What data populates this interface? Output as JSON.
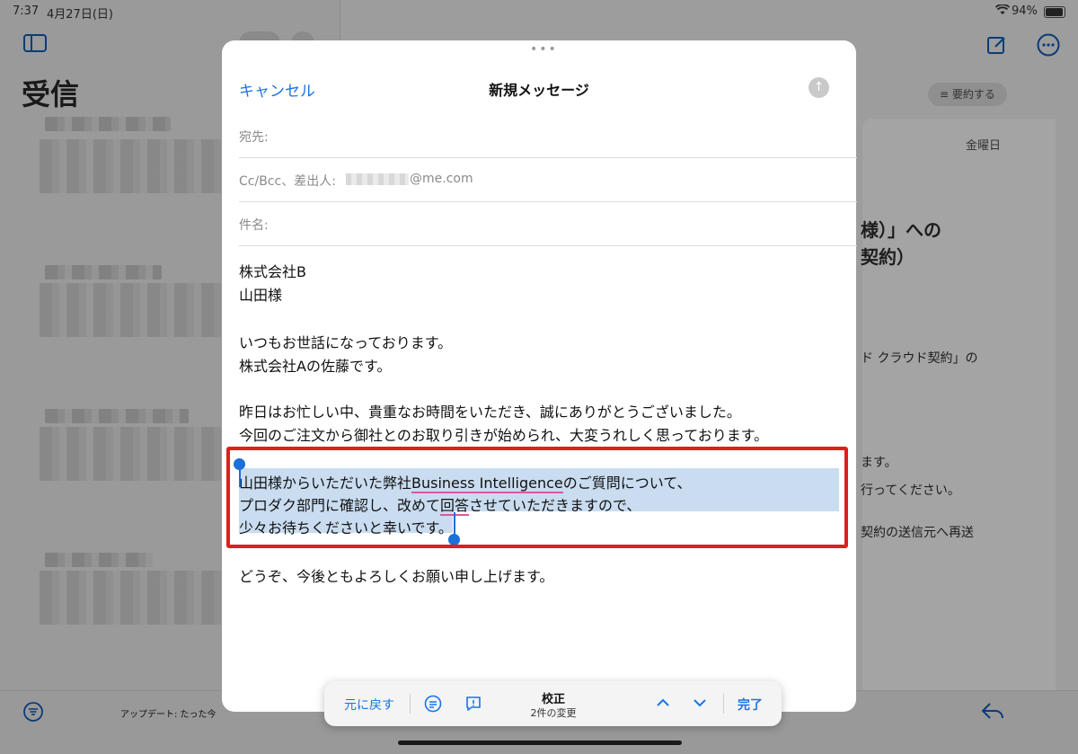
{
  "status_bar": {
    "time": "7:37",
    "date": "4月27日(日)",
    "battery": "94%"
  },
  "mailbox": {
    "title": "受信",
    "update_status": "アップデート: たった今",
    "summarize_label": "要約する",
    "detail_day": "金曜日"
  },
  "background_text": {
    "heading_line1": "様）」への",
    "heading_line2": "契約）",
    "line1": "ド クラウド契約」の",
    "line2": "ます。",
    "line3": "行ってください。",
    "line4": "契約の送信元へ再送"
  },
  "compose": {
    "cancel": "キャンセル",
    "title": "新規メッセージ",
    "to_label": "宛先:",
    "cc_label": "Cc/Bcc、差出人:",
    "from_value": "@me.com",
    "subject_label": "件名:",
    "body": {
      "l1": "株式会社B",
      "l2": "山田様",
      "l3": "いつもお世話になっております。",
      "l4": "株式会社Aの佐藤です。",
      "l5": "昨日はお忙しい中、貴重なお時間をいただき、誠にありがとうございました。",
      "l6": "今回のご注文から御社とのお取り引きが始められ、大変うれしく思っております。",
      "s1a": "山田様からいただいた弊社",
      "s1b": "Business Intelligence",
      "s1c": "のご質問について、",
      "s2a": "プロダク部門に確認し、改めて",
      "s2b": "回答",
      "s2c": "させていただきますので、",
      "s3": "少々お待ちくださいと幸いです。",
      "l7": "どうぞ、今後ともよろしくお願い申し上げます。"
    }
  },
  "proofread_toolbar": {
    "undo": "元に戻す",
    "title": "校正",
    "changes": "2件の変更",
    "done": "完了"
  },
  "colors": {
    "accent": "#1a73e8",
    "highlight_box": "#e21d1d",
    "selection": "#c9dcf0"
  }
}
